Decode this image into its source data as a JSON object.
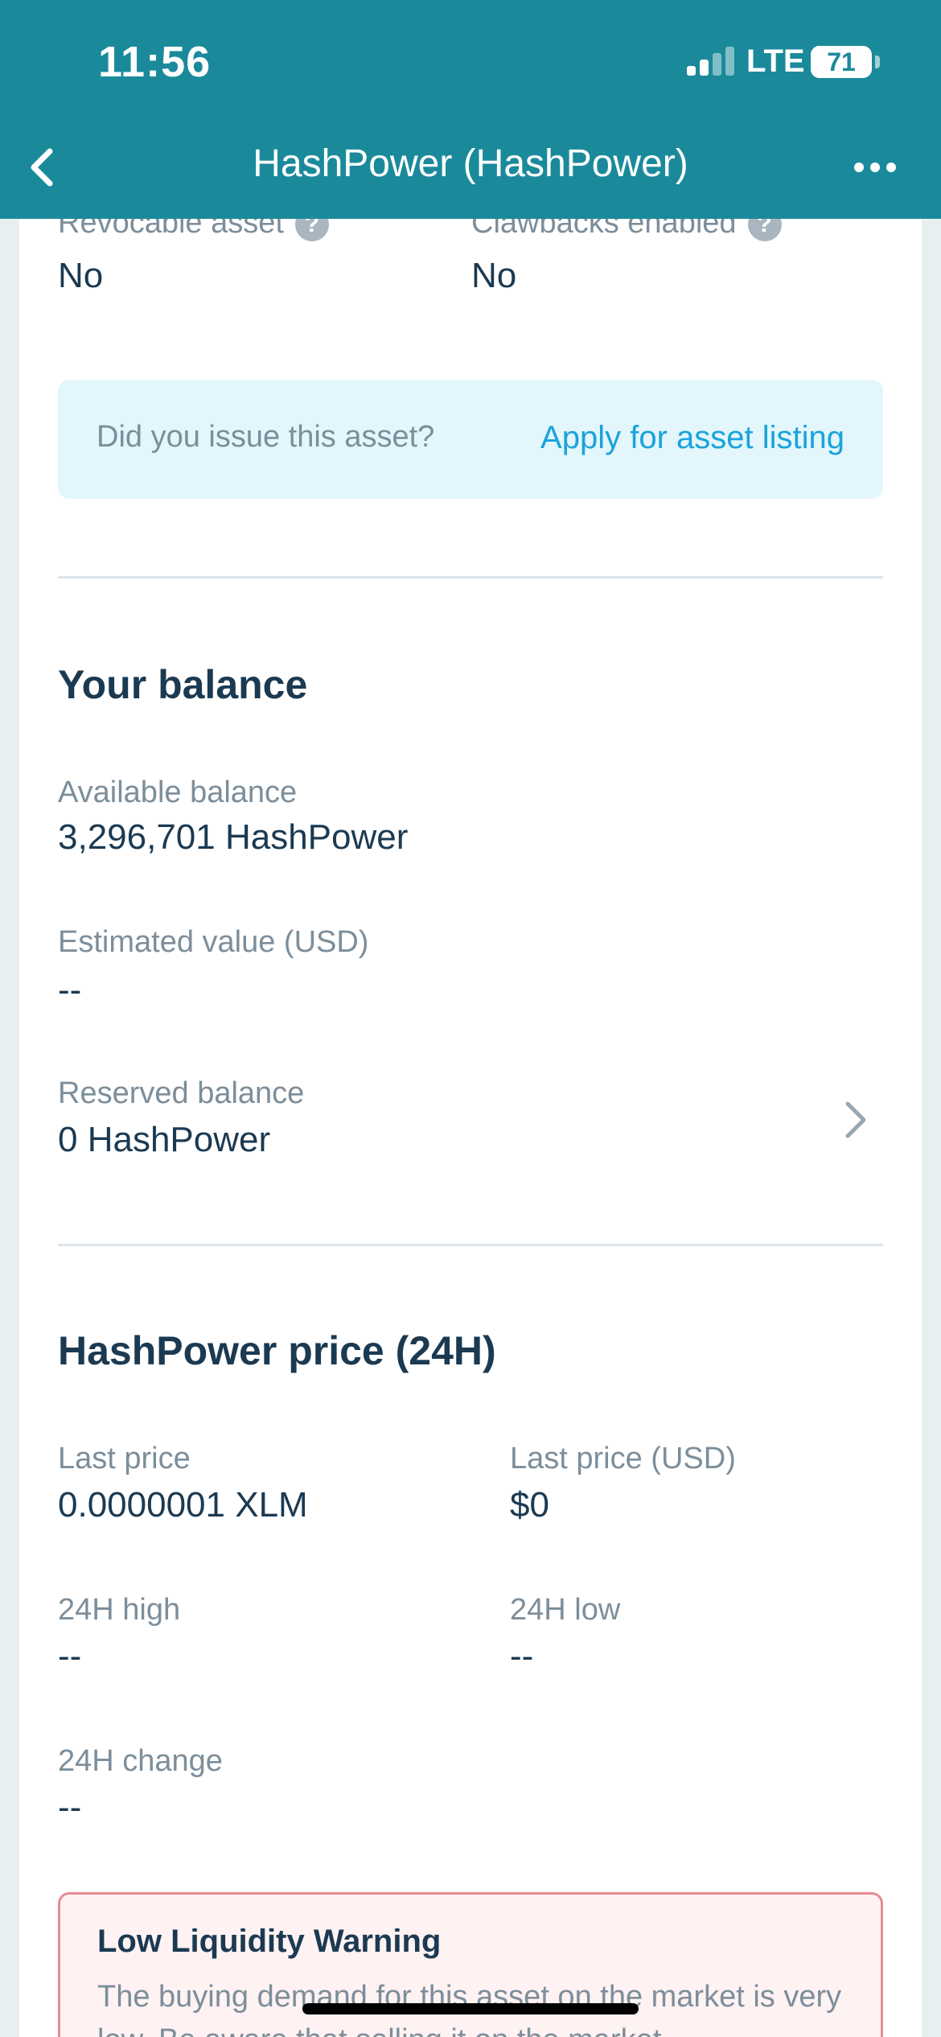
{
  "status_bar": {
    "time": "11:56",
    "carrier": "LTE",
    "battery": "71"
  },
  "header": {
    "title": "HashPower (HashPower)",
    "back_icon": "chevron-left-icon",
    "more_icon": "more-horizontal-icon",
    "background_color": "#1a8a9b"
  },
  "asset_flags": {
    "revocable_label": "Revocable asset",
    "revocable_value": "No",
    "clawbacks_label": "Clawbacks enabled",
    "clawbacks_value": "No",
    "help_icon_glyph": "?"
  },
  "listing": {
    "question": "Did you issue this asset?",
    "link": "Apply for asset listing"
  },
  "balance": {
    "title": "Your balance",
    "available_label": "Available balance",
    "available_value": "3,296,701 HashPower",
    "estimated_label": "Estimated value (USD)",
    "estimated_value": "--",
    "reserved_label": "Reserved balance",
    "reserved_value": "0 HashPower"
  },
  "price": {
    "title": "HashPower price (24H)",
    "last_price_label": "Last price",
    "last_price_value": "0.0000001 XLM",
    "last_price_usd_label": "Last price (USD)",
    "last_price_usd_value": "$0",
    "high_label": "24H high",
    "high_value": "--",
    "low_label": "24H low",
    "low_value": "--",
    "change_label": "24H change",
    "change_value": "--"
  },
  "warning": {
    "title": "Low Liquidity Warning",
    "text": "The buying demand for this asset on the market is very low. Be aware that selling it on the market"
  },
  "colors": {
    "accent": "#1aa3dc",
    "text": "#1b3a52",
    "muted": "#7c8e9b",
    "warning_border": "#e88b94"
  }
}
